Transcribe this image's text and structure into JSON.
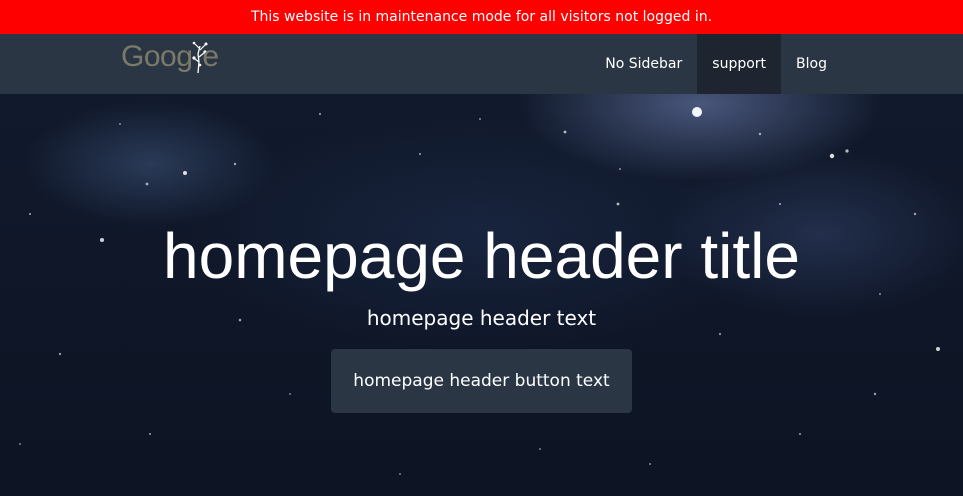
{
  "maintenance_banner": {
    "text": "This website is in maintenance mode for all visitors not logged in.",
    "color": "#ff0000"
  },
  "navbar": {
    "logo": {
      "text": "Goog",
      "text_end": "e",
      "icon": "sprig-icon"
    },
    "links": [
      {
        "label": "No Sidebar",
        "active": false
      },
      {
        "label": "support",
        "active": true
      },
      {
        "label": "Blog",
        "active": false
      }
    ],
    "background": "#2b3645"
  },
  "hero": {
    "title": "homepage header title",
    "text": "homepage header text",
    "button_label": "homepage header button text"
  }
}
